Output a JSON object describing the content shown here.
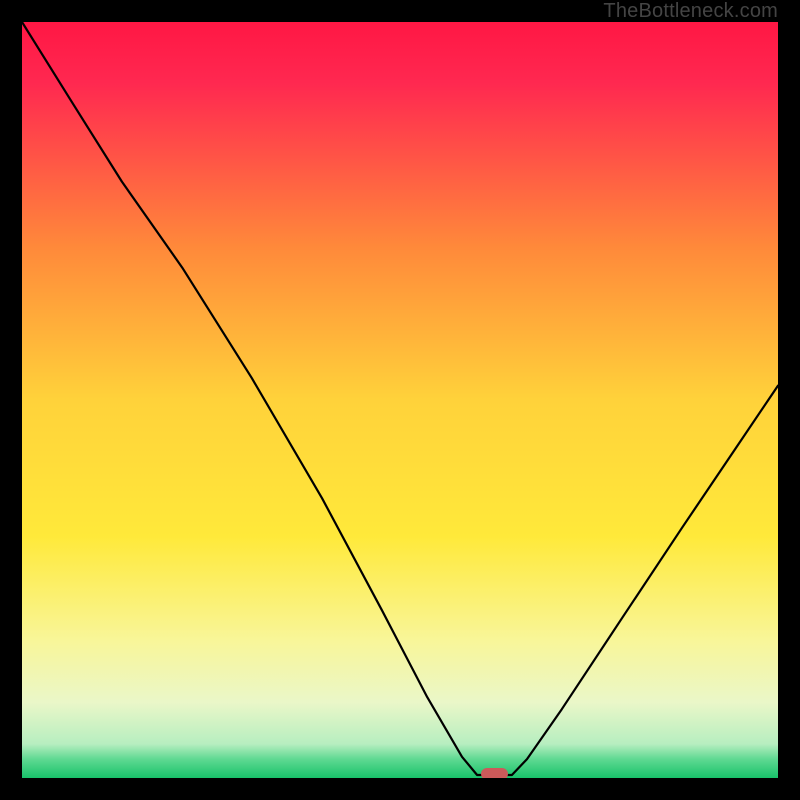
{
  "watermark": {
    "text": "TheBottleneck.com"
  },
  "colors": {
    "frame": "#000000",
    "curve": "#000000",
    "marker": "#cc5a5a",
    "gradient_stops": [
      {
        "offset": 0.0,
        "color": "#ff1744"
      },
      {
        "offset": 0.08,
        "color": "#ff2850"
      },
      {
        "offset": 0.3,
        "color": "#ff8a3a"
      },
      {
        "offset": 0.5,
        "color": "#ffd23a"
      },
      {
        "offset": 0.68,
        "color": "#ffe93a"
      },
      {
        "offset": 0.82,
        "color": "#f8f69a"
      },
      {
        "offset": 0.9,
        "color": "#eaf7c8"
      },
      {
        "offset": 0.955,
        "color": "#b7eec0"
      },
      {
        "offset": 0.975,
        "color": "#5fd992"
      },
      {
        "offset": 1.0,
        "color": "#18c26a"
      }
    ]
  },
  "chart_data": {
    "type": "line",
    "title": "",
    "xlabel": "",
    "ylabel": "",
    "xlim": [
      0,
      100
    ],
    "ylim": [
      0,
      100
    ],
    "series": [
      {
        "name": "curve",
        "note": "V-shaped curve; y read as percent of plot-area height from bottom (0 = bottom). Values estimated from pixels.",
        "points": [
          {
            "x": 0.0,
            "y": 100.0
          },
          {
            "x": 6.6,
            "y": 89.4
          },
          {
            "x": 13.2,
            "y": 78.9
          },
          {
            "x": 21.2,
            "y": 67.5
          },
          {
            "x": 30.4,
            "y": 52.9
          },
          {
            "x": 39.7,
            "y": 37.0
          },
          {
            "x": 47.6,
            "y": 22.2
          },
          {
            "x": 53.6,
            "y": 10.7
          },
          {
            "x": 58.2,
            "y": 2.8
          },
          {
            "x": 60.2,
            "y": 0.4
          },
          {
            "x": 64.8,
            "y": 0.4
          },
          {
            "x": 66.8,
            "y": 2.5
          },
          {
            "x": 71.4,
            "y": 9.1
          },
          {
            "x": 79.4,
            "y": 21.2
          },
          {
            "x": 87.3,
            "y": 33.1
          },
          {
            "x": 94.0,
            "y": 43.0
          },
          {
            "x": 100.0,
            "y": 51.9
          }
        ]
      }
    ],
    "marker": {
      "name": "highlight",
      "x_center": 62.5,
      "y": 0.5,
      "width_pct": 3.5,
      "height_pct": 1.6
    }
  }
}
